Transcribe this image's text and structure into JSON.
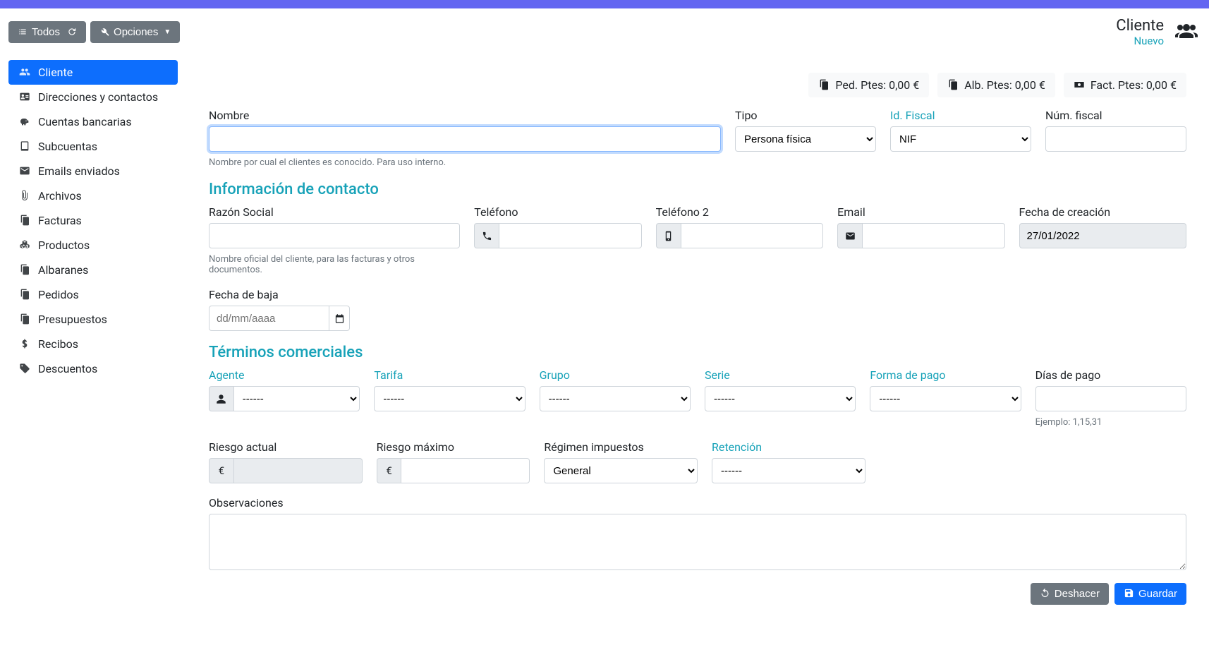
{
  "header": {
    "btn_todos": "Todos",
    "btn_opciones": "Opciones",
    "title": "Cliente",
    "subtitle": "Nuevo"
  },
  "sidebar": {
    "items": [
      "Cliente",
      "Direcciones y contactos",
      "Cuentas bancarias",
      "Subcuentas",
      "Emails enviados",
      "Archivos",
      "Facturas",
      "Productos",
      "Albaranes",
      "Pedidos",
      "Presupuestos",
      "Recibos",
      "Descuentos"
    ]
  },
  "stats": {
    "ped": "Ped. Ptes: 0,00 €",
    "alb": "Alb. Ptes: 0,00 €",
    "fact": "Fact. Ptes: 0,00 €"
  },
  "form": {
    "nombre_label": "Nombre",
    "nombre_help": "Nombre por cual el clientes es conocido. Para uso interno.",
    "tipo_label": "Tipo",
    "tipo_value": "Persona física",
    "idfiscal_label": "Id. Fiscal",
    "idfiscal_value": "NIF",
    "numfiscal_label": "Núm. fiscal",
    "section_contacto": "Información de contacto",
    "razon_label": "Razón Social",
    "razon_help": "Nombre oficial del cliente, para las facturas y otros documentos.",
    "telefono_label": "Teléfono",
    "telefono2_label": "Teléfono 2",
    "email_label": "Email",
    "fecha_creacion_label": "Fecha de creación",
    "fecha_creacion_value": "27/01/2022",
    "fecha_baja_label": "Fecha de baja",
    "fecha_baja_placeholder": "dd/mm/aaaa",
    "section_terminos": "Términos comerciales",
    "agente_label": "Agente",
    "tarifa_label": "Tarifa",
    "grupo_label": "Grupo",
    "serie_label": "Serie",
    "forma_pago_label": "Forma de pago",
    "dias_pago_label": "Días de pago",
    "dias_pago_help": "Ejemplo: 1,15,31",
    "select_dash": "------",
    "riesgo_actual_label": "Riesgo actual",
    "riesgo_max_label": "Riesgo máximo",
    "regimen_label": "Régimen impuestos",
    "regimen_value": "General",
    "retencion_label": "Retención",
    "observaciones_label": "Observaciones",
    "euro": "€"
  },
  "actions": {
    "deshacer": "Deshacer",
    "guardar": "Guardar"
  }
}
